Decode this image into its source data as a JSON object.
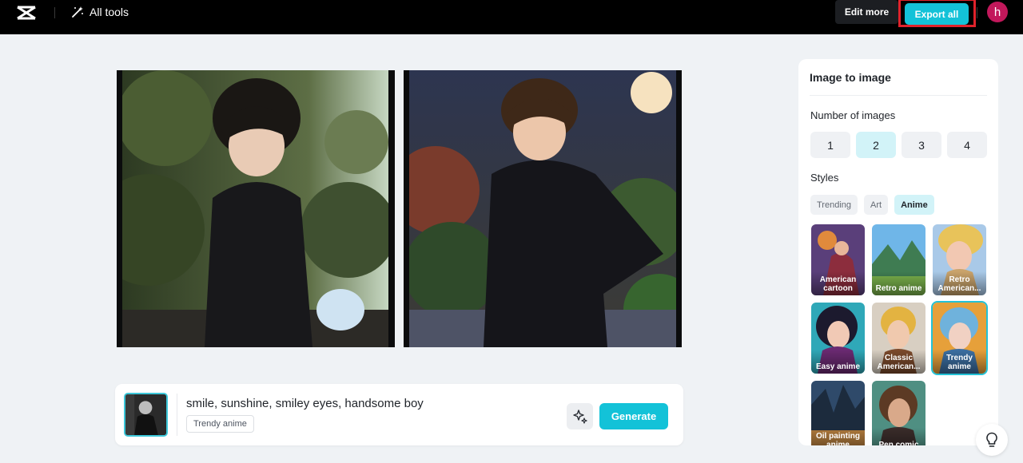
{
  "topbar": {
    "logo_icon": "capcut-logo-icon",
    "all_tools_label": "All tools",
    "all_tools_icon": "magic-wand-icon",
    "edit_more_label": "Edit more",
    "export_all_label": "Export all",
    "avatar_initial": "h",
    "colors": {
      "accent": "#13c2d8",
      "highlight_border": "#e0222b",
      "avatar": "#c2185b"
    }
  },
  "results": [
    {
      "description": "anime boy in black uniform holding a plush toy in a sunlit garden"
    },
    {
      "description": "anime boy in black uniform smiling in a night garden under the moon"
    }
  ],
  "prompt_bar": {
    "prompt_text": "smile, sunshine, smiley eyes, handsome boy",
    "style_tag": "Trendy anime",
    "magic_icon": "sparkle-icon",
    "generate_label": "Generate"
  },
  "panel": {
    "title": "Image to image",
    "number_label": "Number of images",
    "numbers": [
      "1",
      "2",
      "3",
      "4"
    ],
    "selected_number": "2",
    "styles_label": "Styles",
    "style_tabs": [
      "Trending",
      "Art",
      "Anime"
    ],
    "active_style_tab": "Anime",
    "style_cards": [
      {
        "name": "American cartoon"
      },
      {
        "name": "Retro anime"
      },
      {
        "name": "Retro American..."
      },
      {
        "name": "Easy anime"
      },
      {
        "name": "Classic American..."
      },
      {
        "name": "Trendy anime",
        "selected": true
      },
      {
        "name": "Oil painting anime"
      },
      {
        "name": "Pen comic"
      }
    ]
  },
  "help": {
    "icon": "lightbulb-icon"
  }
}
